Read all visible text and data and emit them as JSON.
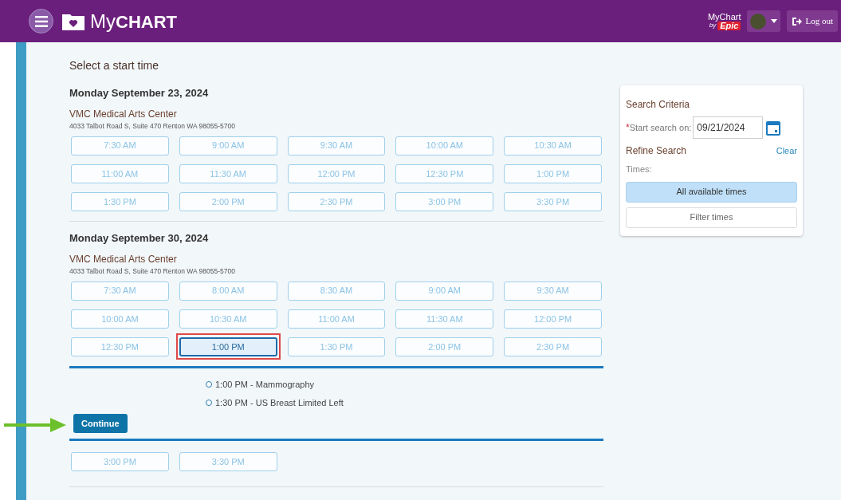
{
  "header": {
    "logo_prefix": "My",
    "logo_main": "CHART",
    "epic_logo": {
      "top": "MyChart",
      "by": "by",
      "brand": "Epic"
    },
    "logout": "Log out"
  },
  "title": "Select a start time",
  "days": [
    {
      "date": "Monday September 23, 2024",
      "location": "VMC Medical Arts Center",
      "address": "4033 Talbot Road S, Suite 470 Renton WA 98055-5700",
      "slots": [
        {
          "time": "7:30 AM",
          "selected": false
        },
        {
          "time": "9:00 AM",
          "selected": false
        },
        {
          "time": "9:30 AM",
          "selected": false
        },
        {
          "time": "10:00 AM",
          "selected": false
        },
        {
          "time": "10:30 AM",
          "selected": false
        },
        {
          "time": "11:00 AM",
          "selected": false
        },
        {
          "time": "11:30 AM",
          "selected": false
        },
        {
          "time": "12:00 PM",
          "selected": false
        },
        {
          "time": "12:30 PM",
          "selected": false
        },
        {
          "time": "1:00 PM",
          "selected": false
        },
        {
          "time": "1:30 PM",
          "selected": false
        },
        {
          "time": "2:00 PM",
          "selected": false
        },
        {
          "time": "2:30 PM",
          "selected": false
        },
        {
          "time": "3:00 PM",
          "selected": false
        },
        {
          "time": "3:30 PM",
          "selected": false
        }
      ]
    },
    {
      "date": "Monday September 30, 2024",
      "location": "VMC Medical Arts Center",
      "address": "4033 Talbot Road S, Suite 470 Renton WA 98055-5700",
      "slots": [
        {
          "time": "7:30 AM",
          "selected": false
        },
        {
          "time": "8:00 AM",
          "selected": false
        },
        {
          "time": "8:30 AM",
          "selected": false
        },
        {
          "time": "9:00 AM",
          "selected": false
        },
        {
          "time": "9:30 AM",
          "selected": false
        },
        {
          "time": "10:00 AM",
          "selected": false
        },
        {
          "time": "10:30 AM",
          "selected": false
        },
        {
          "time": "11:00 AM",
          "selected": false
        },
        {
          "time": "11:30 AM",
          "selected": false
        },
        {
          "time": "12:00 PM",
          "selected": false
        },
        {
          "time": "12:30 PM",
          "selected": false
        },
        {
          "time": "1:00 PM",
          "selected": true
        },
        {
          "time": "1:30 PM",
          "selected": false
        },
        {
          "time": "2:00 PM",
          "selected": false
        },
        {
          "time": "2:30 PM",
          "selected": false
        }
      ],
      "detail": {
        "items": [
          "1:00 PM - Mammography",
          "1:30 PM - US Breast Limited Left"
        ],
        "button": "Continue"
      },
      "more_slots": [
        {
          "time": "3:00 PM",
          "selected": false
        },
        {
          "time": "3:30 PM",
          "selected": false
        }
      ]
    }
  ],
  "sidebar": {
    "title": "Search Criteria",
    "required_mark": "*",
    "start_label": "Start search on:",
    "start_value": "09/21/2024",
    "refine": "Refine Search",
    "clear": "Clear",
    "times_label": "Times:",
    "options": [
      {
        "label": "All available times",
        "selected": true
      },
      {
        "label": "Filter times",
        "selected": false
      }
    ]
  }
}
